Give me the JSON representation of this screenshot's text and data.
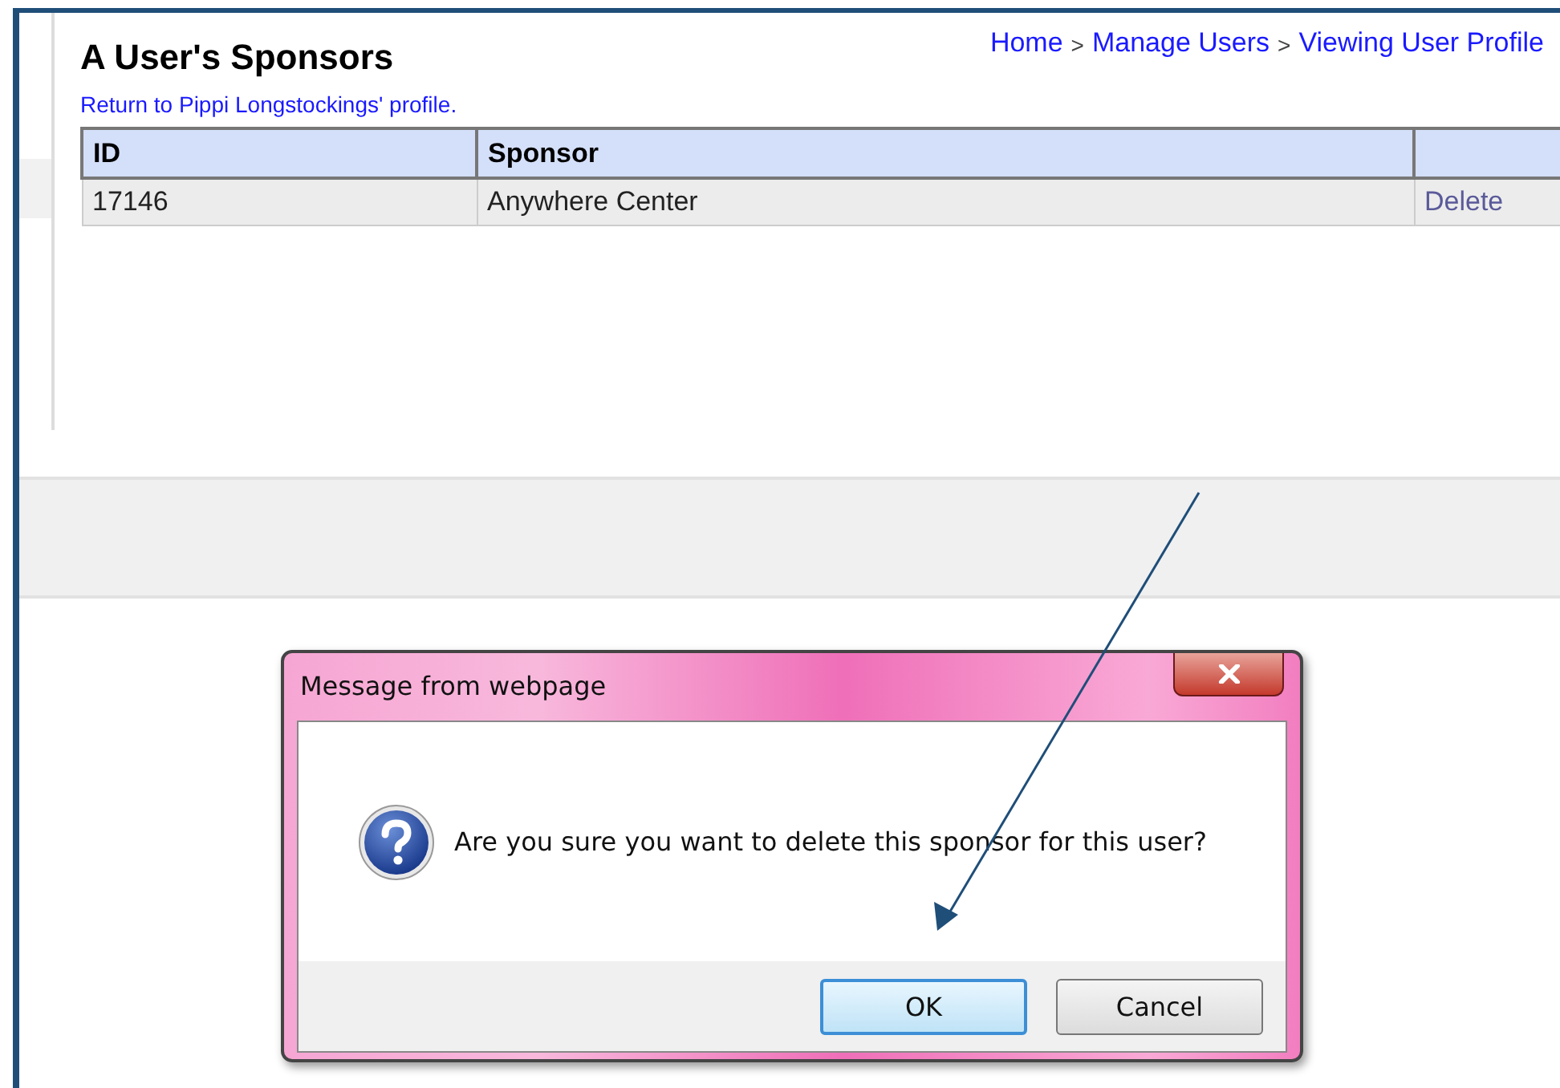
{
  "page": {
    "title": "A User's Sponsors",
    "return_link": "Return to Pippi Longstockings' profile.",
    "breadcrumb": [
      {
        "kind": "link",
        "text": "Home"
      },
      {
        "kind": "separator",
        "text": ">"
      },
      {
        "kind": "link",
        "text": "Manage Users"
      },
      {
        "kind": "separator",
        "text": ">"
      },
      {
        "kind": "link",
        "text": "Viewing User Profile"
      }
    ]
  },
  "table": {
    "columns": [
      "ID",
      "Sponsor"
    ],
    "rows": [
      {
        "id": "17146",
        "sponsor": "Anywhere Center",
        "action": "Delete"
      }
    ]
  },
  "dialog": {
    "title": "Message from webpage",
    "message": "Are you sure you want to delete this sponsor for this user?",
    "buttons": [
      {
        "label": "OK",
        "focused": true
      },
      {
        "label": "Cancel",
        "focused": false
      }
    ]
  }
}
